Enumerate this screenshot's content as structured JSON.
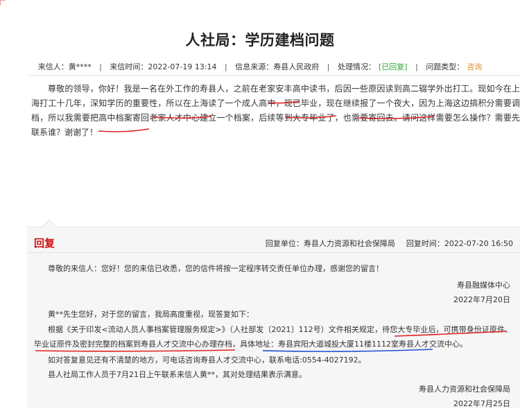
{
  "page": {
    "title": "人社局：学历建档问题"
  },
  "meta": {
    "sender_label": "来信人：",
    "sender": "黄****",
    "date_label": "来信时间：",
    "date": "2022-07-19 13:14",
    "source_label": "信息来源：",
    "source": "寿县人民政府",
    "status_label": "处理情况：",
    "status": "[已回复]",
    "type_label": "问题类型：",
    "type": "咨询"
  },
  "letter": {
    "p1": "尊敬的领导，你好！我是一名在外工作的寿县人，之前在老家安丰",
    "u1": "高中读书",
    "p2": "，后因一些原因读到高二辍学外出打工。现如今在上海打工十几年，深知学历的重要性，所以在上海",
    "u2": "读了一个成人高中",
    "p3": "，现已毕业，现在继续",
    "u3": "报了一个夜大",
    "p4": "，因为",
    "u4": "上海这边搞积分需要调档",
    "p5": "，所以我需要把高中档案寄回老家人才中心",
    "u5": "建立一个档案",
    "p6": "，后续等到大专毕业了，也需要寄回去。请问这样需要怎么操作？需要先联系谁？谢谢了！"
  },
  "reply": {
    "title": "回复",
    "unit_label": "回复单位：",
    "unit": "寿县人力资源和社会保障局",
    "time_label": "回复时间：",
    "time": "2022-07-20 16:50",
    "ack": "尊敬的来信人：您好！您的来信已收悉，您的信件将按一定程序转交责任单位办理，感谢您的留言！",
    "ack_sign": "寿县融媒体中心",
    "ack_date": "2022年7月20日",
    "greeting": "黄**先生您好，对于您的留言，我局高度重视，现答复如下：",
    "body1": "根据《关于印发<流动人员人事档案管理服务规定>》（人社部发〔2021〕112号）文件相关规定，待您",
    "body_u1": "大专毕业后，可携带身份证原件、毕业证原件及密封完整的档案到寿县人才交流中心办理存档",
    "body2": "，具体地址：",
    "body_u2": "寿县宾阳大道城投大厦11楼1112室寿县人才交流中心",
    "body3": "。",
    "contact": "如对答复意见还有不清楚的地方，可电话咨询寿县人才交流中心，联系电话:0554-4027192。",
    "followup": "县人社局工作人员于7月21日上午联系来信人黄**，其对处理结果表示满意。",
    "sign": "寿县人力资源和社会保障局",
    "sign_date": "2022年7月25日"
  },
  "colors": {
    "status_green": "#2fa43a",
    "type_orange": "#e08a1e",
    "reply_red": "#cc1111",
    "annotation_red": "#e02020",
    "annotation_blue": "#1f4fd0"
  }
}
